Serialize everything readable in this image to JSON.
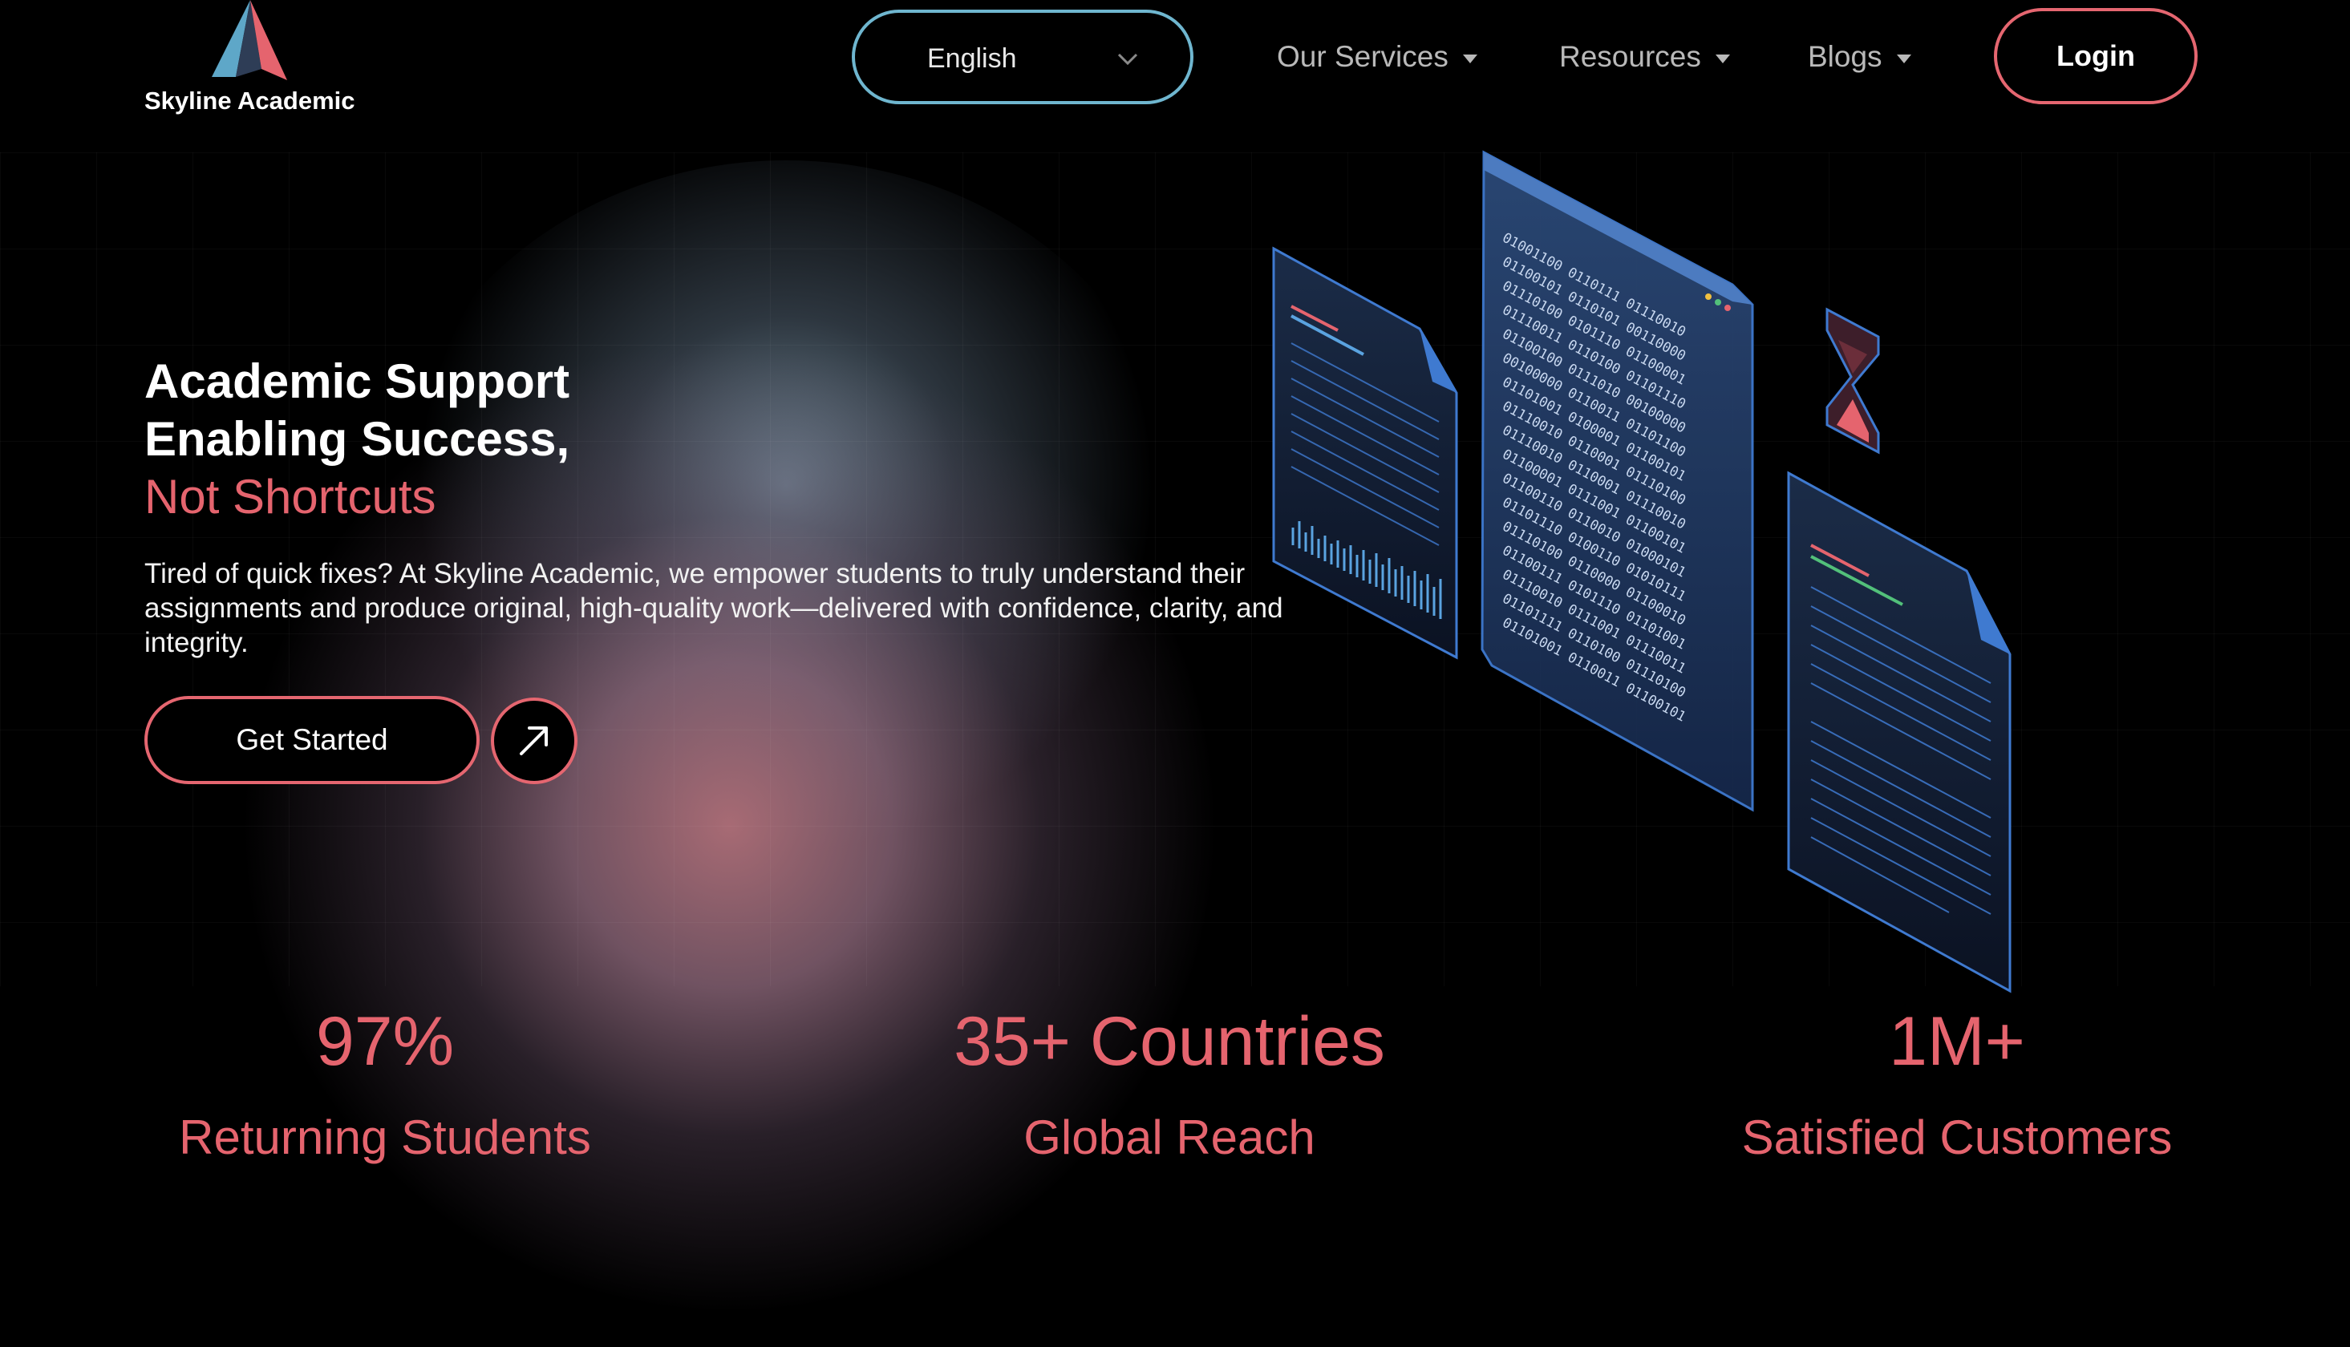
{
  "brand": {
    "name": "Skyline Academic",
    "colors": {
      "accent": "#e5646e",
      "blue": "#6fb6cf",
      "background": "#000000"
    }
  },
  "header": {
    "language": {
      "value": "English",
      "icon": "chevron-down-icon"
    },
    "nav": [
      {
        "label": "Our Services",
        "icon": "caret-down-icon"
      },
      {
        "label": "Resources",
        "icon": "caret-down-icon"
      },
      {
        "label": "Blogs",
        "icon": "caret-down-icon"
      }
    ],
    "login_label": "Login"
  },
  "hero": {
    "title_line1": "Academic Support",
    "title_line2": "Enabling Success,",
    "title_accent": "Not Shortcuts",
    "subtitle": "Tired of quick fixes? At Skyline Academic, we empower students to truly understand their assignments and produce original, high-quality work—delivered with confidence, clarity, and integrity.",
    "cta_label": "Get Started",
    "cta_icon": "arrow-up-right-icon"
  },
  "stats": [
    {
      "value": "97%",
      "label": "Returning Students"
    },
    {
      "value": "35+ Countries",
      "label": "Global Reach"
    },
    {
      "value": "1M+",
      "label": "Satisfied Customers"
    }
  ],
  "illustration": {
    "binary_lines": [
      "01001100 0110111 01110010",
      "01100101 0110101 00110000",
      "01110100 0101110 01100001",
      "01110011 0110100 01101110",
      "01100100 0111010 00100000",
      "00100000 0110011 01101100",
      "01101001 0100001 01100101",
      "01110010 0110001 01110100",
      "01110010 0110001 01110010",
      "01100001 0111001 01100101",
      "01100110 0110010 01000101",
      "01101110 0100110 01010111",
      "01110100 0110000 01100010",
      "01100111 0101110 01101001",
      "01110010 0111001 01110011",
      "01101111 0110100 01110100",
      "01101001 0110011 01100101"
    ]
  }
}
